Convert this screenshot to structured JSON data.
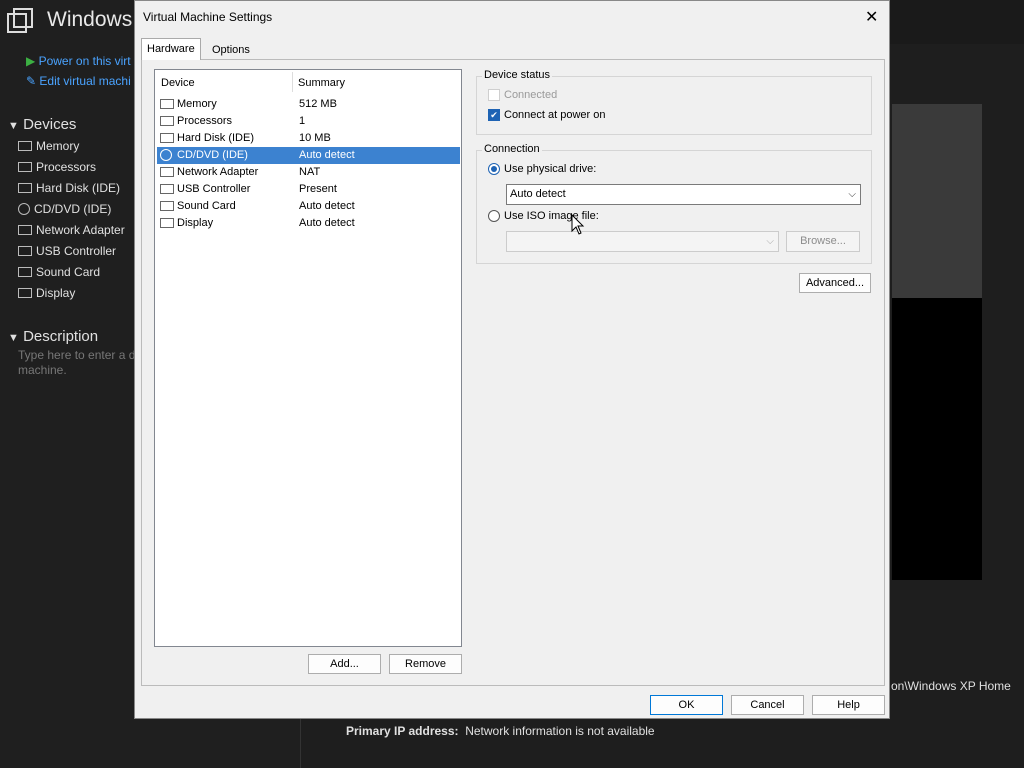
{
  "background": {
    "title": "Windows",
    "actions": [
      "Power on this virt",
      "Edit virtual machi"
    ],
    "devices_header": "Devices",
    "devices": [
      "Memory",
      "Processors",
      "Hard Disk (IDE)",
      "CD/DVD (IDE)",
      "Network Adapter",
      "USB Controller",
      "Sound Card",
      "Display"
    ],
    "description_header": "Description",
    "description_placeholder": "Type here to enter a d machine.",
    "path_text": "on\\Windows XP Home",
    "ip_label": "Primary IP address:",
    "ip_value": "Network information is not available"
  },
  "dialog": {
    "title": "Virtual Machine Settings",
    "close": "✕",
    "tabs": [
      "Hardware",
      "Options"
    ],
    "list_headers": {
      "device": "Device",
      "summary": "Summary"
    },
    "devices": [
      {
        "name": "Memory",
        "summary": "512 MB",
        "icon": "memory-icon"
      },
      {
        "name": "Processors",
        "summary": "1",
        "icon": "processor-icon"
      },
      {
        "name": "Hard Disk (IDE)",
        "summary": "10 MB",
        "icon": "harddisk-icon"
      },
      {
        "name": "CD/DVD (IDE)",
        "summary": "Auto detect",
        "icon": "cd-icon",
        "selected": true
      },
      {
        "name": "Network Adapter",
        "summary": "NAT",
        "icon": "network-icon"
      },
      {
        "name": "USB Controller",
        "summary": "Present",
        "icon": "usb-icon"
      },
      {
        "name": "Sound Card",
        "summary": "Auto detect",
        "icon": "speaker-icon"
      },
      {
        "name": "Display",
        "summary": "Auto detect",
        "icon": "display-icon"
      }
    ],
    "add_label": "Add...",
    "remove_label": "Remove",
    "device_status": {
      "label": "Device status",
      "connected": "Connected",
      "connect_at_power_on": "Connect at power on"
    },
    "connection": {
      "label": "Connection",
      "physical": "Use physical drive:",
      "physical_value": "Auto detect",
      "iso": "Use ISO image file:",
      "browse": "Browse..."
    },
    "advanced_label": "Advanced...",
    "ok_label": "OK",
    "cancel_label": "Cancel",
    "help_label": "Help"
  }
}
